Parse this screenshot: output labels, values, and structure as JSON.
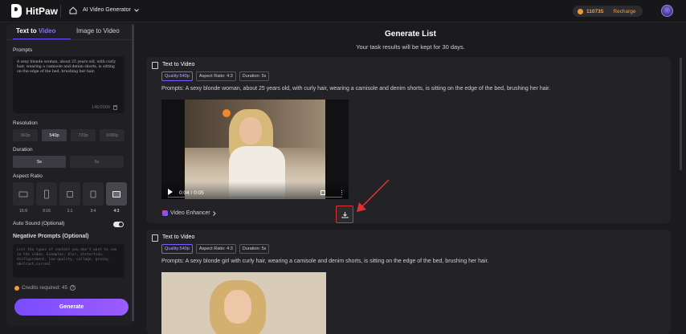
{
  "topbar": {
    "brand": "HitPaw",
    "nav_title": "AI Video Generator",
    "credits": "110735",
    "recharge": "Recharge"
  },
  "sidebar": {
    "tab_text_prefix": "Text to ",
    "tab_text_highlight": "Video",
    "tab_image": "Image to Video",
    "prompts_label": "Prompts",
    "prompt_text": "A sexy blonde woman, about 25 years old, with curly hair, wearing a camisole and denim shorts, is sitting on the edge of the bed, brushing her hair.",
    "prompt_count": "146/2000",
    "resolution_label": "Resolution",
    "resolutions": [
      "360p",
      "540p",
      "720p",
      "1080p"
    ],
    "duration_label": "Duration",
    "durations": [
      "5s",
      "8s"
    ],
    "aspect_label": "Aspect Ratio",
    "aspects": [
      "16:9",
      "9:16",
      "1:1",
      "3:4",
      "4:3"
    ],
    "auto_sound": "Auto Sound (Optional)",
    "negative_label": "Negative Prompts (Optional)",
    "negative_placeholder": "List the types of content you don't want to see in the video. Examples: blur, distortion, disfigurement, low quality, collage, grainy, abstract,surreal",
    "credits_required": "Credits required: 45",
    "generate": "Generate"
  },
  "main": {
    "title": "Generate List",
    "subtitle": "Your task results will be kept for 30 days.",
    "cards": [
      {
        "title": "Text to Video",
        "tags": [
          "Quality:540p",
          "Aspect Ratio: 4:3",
          "Duration: 5s"
        ],
        "prompt": "Prompts:  A sexy blonde woman, about 25 years old, with curly hair, wearing a camisole and denim shorts, is sitting on the edge of the bed, brushing her hair.",
        "time": "0:04 / 0:05",
        "enhancer": "Video Enhancer"
      },
      {
        "title": "Text to Video",
        "tags": [
          "Quality:540p",
          "Aspect Ratio: 4:3",
          "Duration: 5s"
        ],
        "prompt": "Prompts:  A sexy blonde girl with curly hair, wearing a camisole and denim shorts, is sitting on the edge of the bed, brushing her hair."
      }
    ]
  },
  "colors": {
    "accent": "#7a4cff",
    "credit": "#f0a040",
    "highlight_box": "#e23030"
  }
}
